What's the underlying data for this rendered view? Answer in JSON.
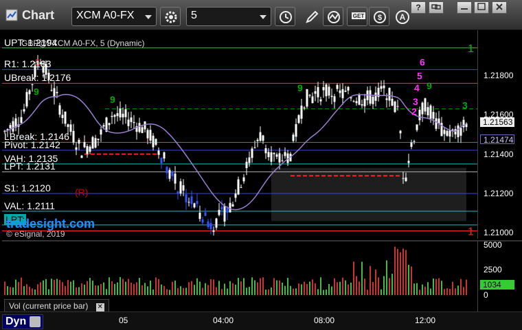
{
  "toolbar": {
    "title": "Chart",
    "symbol": "XCM A0-FX",
    "interval": "5"
  },
  "chart": {
    "symbol_line": "GBP@FXCM A0-FX, 5 (Dynamic)",
    "watermark": "tradesight.com",
    "copyright": "© eSignal, 2019",
    "levels": [
      {
        "label": "UPT: 1.2194",
        "price": 1.2194,
        "color": "#00bb00",
        "dash": false
      },
      {
        "label": "R1: 1.2183",
        "price": 1.2183,
        "color": "#3344ff",
        "dash": false
      },
      {
        "label": "UBreak: 1.2176",
        "price": 1.2176,
        "color": "#ff3333",
        "dash": false
      },
      {
        "label": "LBreak: 1.2146",
        "price": 1.2146,
        "color": "#ff3333",
        "dash": false
      },
      {
        "label": "Pivot: 1.2142",
        "price": 1.2142,
        "color": "#3344ff",
        "dash": false
      },
      {
        "label": "VAH: 1.2135",
        "price": 1.2135,
        "color": "#00cccc",
        "dash": false
      },
      {
        "label": "LPT: 1.2131",
        "price": 1.2131,
        "color": "#aaaaaa",
        "dash": false
      },
      {
        "label": "S1: 1.2120",
        "price": 1.212,
        "color": "#3344ff",
        "dash": false
      },
      {
        "label": "VAL: 1.2111",
        "price": 1.2111,
        "color": "#00cccc",
        "dash": false
      },
      {
        "label": "LPT:",
        "price": 1.2104,
        "color": "#00cccc",
        "dash": false
      }
    ],
    "extra_lines": [
      {
        "price": 1.2194,
        "color": "#00bb00"
      },
      {
        "price": 1.2101,
        "color": "#ff2222"
      }
    ],
    "line_numbers": [
      {
        "text": "1",
        "price": 1.2194,
        "color": "#00bb00"
      },
      {
        "text": "1",
        "price": 1.2101,
        "color": "#ff2222"
      }
    ],
    "r_marker": "(R)",
    "last_price": "1.21563",
    "ma_value": "1.21474",
    "price_scale": {
      "min": 1.2097,
      "max": 1.2203,
      "ticks": [
        "1.21800",
        "1.21600",
        "1.21400",
        "1.21200",
        "1.21000"
      ],
      "tick_values": [
        1.218,
        1.216,
        1.214,
        1.212,
        1.21
      ]
    },
    "seq_labels": [
      "6",
      "5",
      "4",
      "3",
      "2",
      "9",
      "9",
      "9",
      "9",
      "3",
      "1"
    ]
  },
  "volume": {
    "label": "Vol (current price bar)",
    "ticks": [
      "5000",
      "2500",
      "0"
    ],
    "tick_values": [
      5000,
      2500,
      0
    ],
    "max": 5200,
    "current": "1034"
  },
  "time_axis": {
    "ticks": [
      "05",
      "04:00",
      "08:00",
      "12:00"
    ]
  },
  "footer": {
    "dyn_label": "Dyn"
  }
}
